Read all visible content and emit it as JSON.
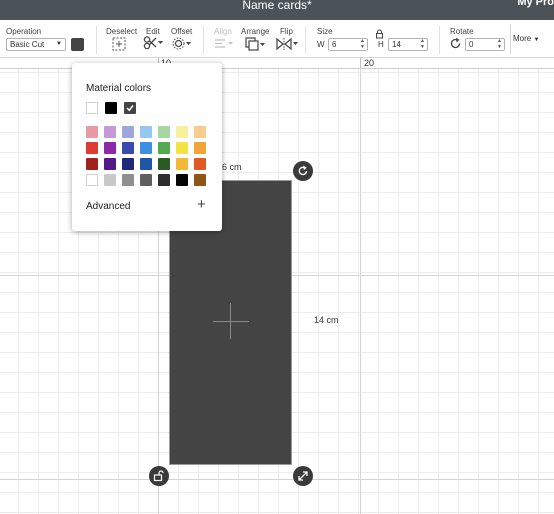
{
  "window": {
    "title": "Name cards*",
    "project_label": "My Pro"
  },
  "toolbar": {
    "operation_label": "Operation",
    "operation_value": "Basic Cut",
    "deselect_label": "Deselect",
    "edit_label": "Edit",
    "offset_label": "Offset",
    "align_label": "Align",
    "arrange_label": "Arrange",
    "flip_label": "Flip",
    "size_label": "Size",
    "width_prefix": "W",
    "width_value": "6",
    "height_prefix": "H",
    "height_value": "14",
    "rotate_label": "Rotate",
    "rotate_value": "0",
    "more_label": "More"
  },
  "ruler": {
    "labels": [
      "10",
      "20"
    ]
  },
  "canvas": {
    "width_label": "6 cm",
    "height_label": "14 cm",
    "shape_color": "#444444"
  },
  "color_popup": {
    "title": "Material colors",
    "advanced_label": "Advanced",
    "top_swatches": [
      "#ffffff",
      "#000000",
      "#444444"
    ],
    "selected_swatch": "#444444",
    "grid": [
      [
        "#e79aa3",
        "#c59ad6",
        "#9ea6dc",
        "#95c7f0",
        "#a6d6a2",
        "#f8f09d",
        "#f9cc8f"
      ],
      [
        "#de3c32",
        "#8e2aa8",
        "#3c4aae",
        "#3e8fe0",
        "#53a94f",
        "#f2e447",
        "#f2a33a"
      ],
      [
        "#a1211c",
        "#531a87",
        "#21287a",
        "#2055a3",
        "#2c5a25",
        "#f1b83a",
        "#e15a26"
      ],
      [
        "#ffffff",
        "#c8c8c8",
        "#8e8e8e",
        "#5f5f5f",
        "#2d2d2d",
        "#050505",
        "#8f5515"
      ]
    ]
  }
}
